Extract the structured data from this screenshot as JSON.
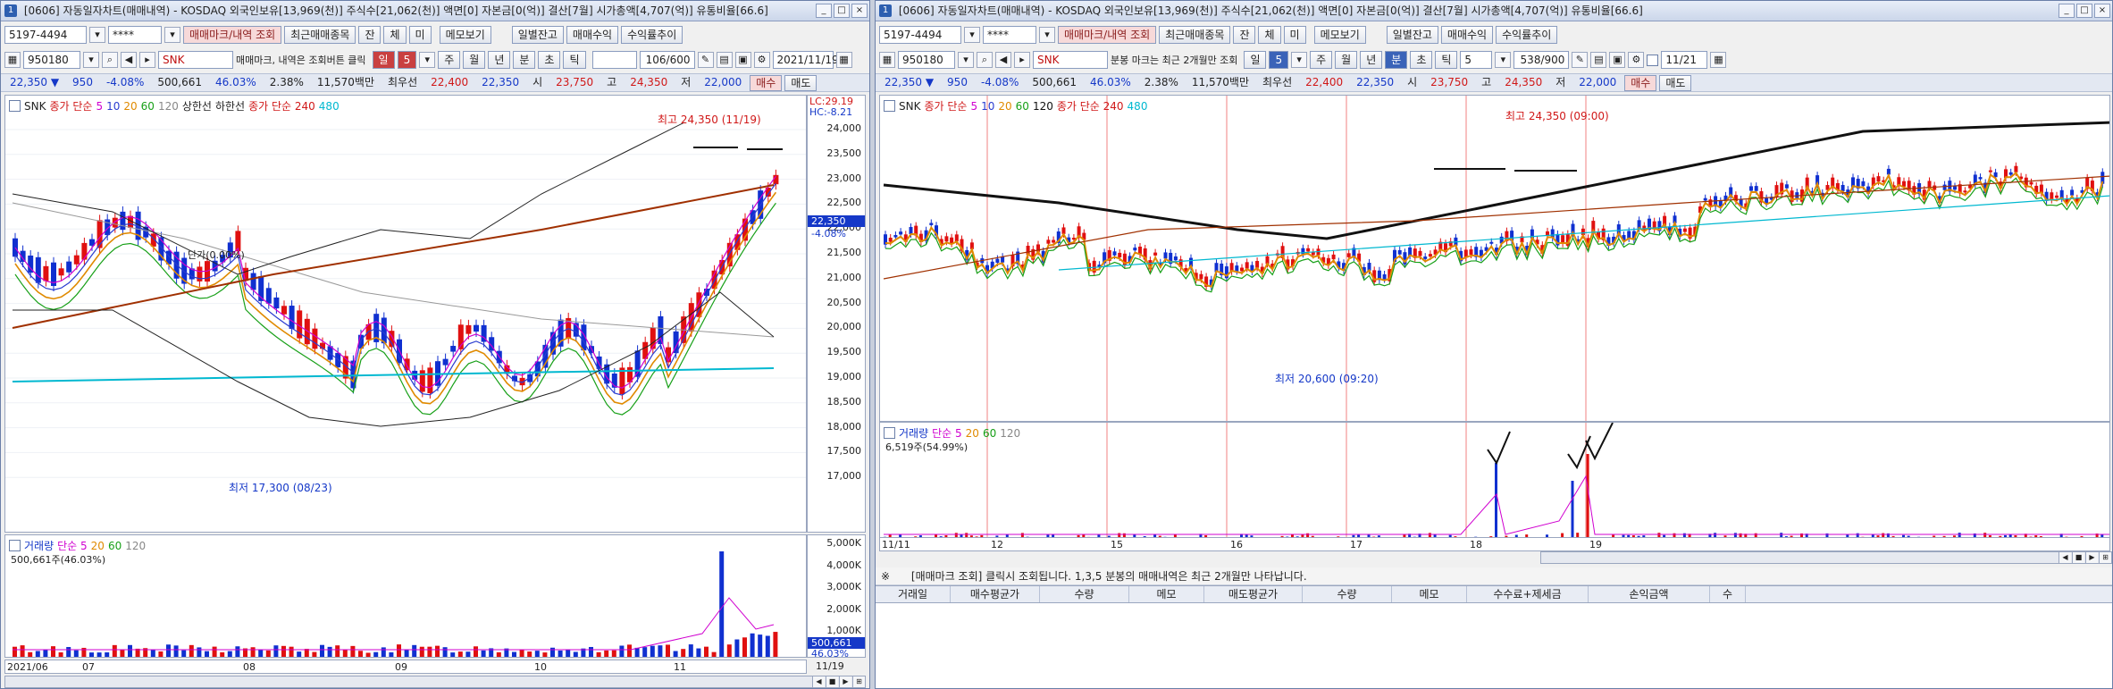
{
  "left": {
    "title": "[0606] 자동일자차트(매매내역) - KOSDAQ 외국인보유[13,969(천)] 주식수[21,062(천)] 액면[0] 자본금[0(억)] 결산[7월] 시가총액[4,707(억)] 유통비율[66.6]",
    "toolbar1": {
      "account": "5197-4494",
      "password": "****",
      "btn_trade_query": "매매마크/내역 조회",
      "btn_recent": "최근매매종목",
      "btn_jan": "잔",
      "btn_che": "체",
      "btn_mi": "미",
      "btn_memo": "메모보기",
      "btn_daily": "일별잔고",
      "btn_profit": "매매수익",
      "btn_rate": "수익률추이"
    },
    "toolbar2": {
      "code": "950180",
      "name": "SNK",
      "hint": "매매마크, 내역은 조회버튼 클릭",
      "period_selected": "일",
      "period_num": "5",
      "tabs": [
        "주",
        "월",
        "년",
        "분",
        "초",
        "틱"
      ],
      "count": "106/600",
      "date": "2021/11/19"
    },
    "stats": {
      "price": "22,350",
      "change": "950",
      "pct": "-4.08%",
      "volume": "500,661",
      "vol_pct": "46.03%",
      "turnover": "2.38%",
      "amount": "11,570백만",
      "best_label": "최우선",
      "bid": "22,400",
      "ask": "22,350",
      "open_label": "시",
      "open": "23,750",
      "high_label": "고",
      "high": "24,350",
      "low_label": "저",
      "low": "22,000",
      "buy_btn": "매수",
      "sell_btn": "매도"
    },
    "legend": {
      "name": "SNK",
      "ma_label": "종가 단순",
      "ma_periods": [
        "5",
        "10",
        "20",
        "60",
        "120"
      ],
      "extra1": "상한선",
      "extra2": "하한선",
      "ma2_label": "종가 단순 240",
      "ma2_period": "480"
    },
    "price_axis": [
      "24,000",
      "23,500",
      "23,000",
      "22,500",
      "22,000",
      "21,500",
      "21,000",
      "20,500",
      "20,000",
      "19,500",
      "19,000",
      "18,500",
      "18,000",
      "17,500",
      "17,000"
    ],
    "price_current": "22,350",
    "price_current_pct": "-4.08%",
    "lc_hc": {
      "lc": "LC:29.19",
      "hc": "HC:-8.21"
    },
    "high_marker": "최고 24,350 (11/19)",
    "low_marker": "최저 17,300 (08/23)",
    "ref_label": "단가(0.00%)",
    "vol_legend": {
      "label": "거래량",
      "ma": "단순 5",
      "p2": "20",
      "p3": "60",
      "p4": "120",
      "value": "500,661주(46.03%)"
    },
    "vol_axis": [
      "5,000K",
      "4,000K",
      "3,000K",
      "2,000K",
      "1,000K"
    ],
    "vol_current": "500,661",
    "vol_current_pct": "46.03%",
    "x_labels": [
      "2021/06",
      "07",
      "08",
      "09",
      "10",
      "11"
    ],
    "x_end": "11/19"
  },
  "right": {
    "title": "[0606] 자동일자차트(매매내역) - KOSDAQ 외국인보유[13,969(천)] 주식수[21,062(천)] 액면[0] 자본금[0(억)] 결산[7월] 시가총액[4,707(억)] 유통비율[66.6]",
    "toolbar1": {
      "account": "5197-4494",
      "password": "****",
      "btn_trade_query": "매매마크/내역 조회",
      "btn_recent": "최근매매종목",
      "btn_jan": "잔",
      "btn_che": "체",
      "btn_mi": "미",
      "btn_memo": "메모보기",
      "btn_daily": "일별잔고",
      "btn_profit": "매매수익",
      "btn_rate": "수익률추이"
    },
    "toolbar2": {
      "code": "950180",
      "name": "SNK",
      "hint": "분봉 마크는 최근 2개월만 조회",
      "period_selected": "일",
      "period_num": "5",
      "tabs": [
        "주",
        "월",
        "년",
        "분",
        "초",
        "틱"
      ],
      "min_num": "5",
      "count": "538/900",
      "date": "11/21"
    },
    "stats": {
      "price": "22,350",
      "change": "950",
      "pct": "-4.08%",
      "volume": "500,661",
      "vol_pct": "46.03%",
      "turnover": "2.38%",
      "amount": "11,570백만",
      "best_label": "최우선",
      "bid": "22,400",
      "ask": "22,350",
      "open_label": "시",
      "open": "23,750",
      "high_label": "고",
      "high": "24,350",
      "low_label": "저",
      "low": "22,000",
      "buy_btn": "매수",
      "sell_btn": "매도"
    },
    "legend": {
      "name": "SNK",
      "ma_label": "종가 단순",
      "ma_periods": [
        "5",
        "10",
        "20",
        "60",
        "120"
      ],
      "ma2_label": "종가 단순 240",
      "ma2_period": "480"
    },
    "high_marker": "최고 24,350 (09:00)",
    "low_marker": "최저 20,600 (09:20)",
    "vol_legend": {
      "label": "거래량",
      "ma": "단순 5",
      "p2": "20",
      "p3": "60",
      "p4": "120",
      "value": "6,519주(54.99%)"
    },
    "x_labels": [
      "11/11",
      "12",
      "15",
      "16",
      "17",
      "18",
      "19"
    ],
    "notice": {
      "mark": "※",
      "text": "[매매마크 조회] 클릭시 조회됩니다. 1,3,5 분봉의 매매내역은 최근 2개월만 나타납니다."
    },
    "table_headers": [
      "거래일",
      "매수평균가",
      "수량",
      "메모",
      "매도평균가",
      "수량",
      "메모",
      "수수료+제세금",
      "손익금액",
      "수"
    ]
  }
}
